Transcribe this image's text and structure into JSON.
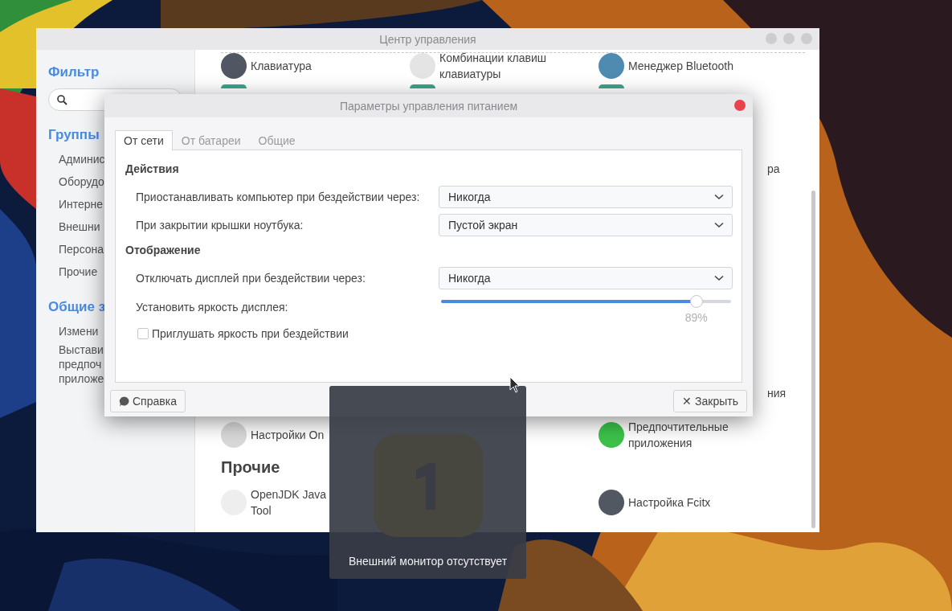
{
  "main_window": {
    "title": "Центр управления",
    "sidebar": {
      "filter_title": "Фильтр",
      "sections": [
        {
          "title": "Группы",
          "items": [
            "Админис",
            "Оборудо",
            "Интерне",
            "Внешни",
            "Персона",
            "Прочие"
          ]
        },
        {
          "title": "Общие з",
          "items": [
            "Измени",
            "Выстави\nпредпоч\nприложе"
          ]
        }
      ]
    },
    "top_rows": [
      {
        "items": [
          {
            "label": "Клавиатура"
          },
          {
            "label": "Комбинации клавиш\nклавиатуры"
          },
          {
            "label": "Менеджер Bluetooth"
          }
        ]
      }
    ],
    "fragment_top": "ра",
    "fragment_bottom": "ния",
    "bottom_rows": [
      {
        "items": [
          {
            "label": "Настройки On"
          },
          {
            "label": "Предпочтительные\nприложения"
          }
        ]
      }
    ],
    "other_title": "Прочие",
    "other_rows": [
      {
        "items": [
          {
            "label": "OpenJDK Java\nTool"
          },
          {
            "label": "Настройка Fcitx"
          }
        ]
      }
    ]
  },
  "dialog": {
    "title": "Параметры управления питанием",
    "tabs": [
      {
        "label": "От сети",
        "selected": true
      },
      {
        "label": "От батареи",
        "selected": false
      },
      {
        "label": "Общие",
        "selected": false
      }
    ],
    "sections": [
      {
        "title": "Действия",
        "rows": [
          {
            "kind": "combo",
            "label": "Приостанавливать компьютер при бездействии через:",
            "value": "Никогда"
          },
          {
            "kind": "combo",
            "label": "При закрытии крышки ноутбука:",
            "value": "Пустой экран"
          }
        ]
      },
      {
        "title": "Отображение",
        "rows": [
          {
            "kind": "combo",
            "label": "Отключать дисплей при бездействии через:",
            "value": "Никогда"
          },
          {
            "kind": "slider",
            "label": "Установить яркость дисплея:",
            "level": 0.88,
            "reading": "89%"
          },
          {
            "kind": "checkbox",
            "label": "Приглушать яркость при бездействии",
            "checked": false
          }
        ]
      }
    ],
    "help_button": "Справка",
    "close_button": "✕ Закрыть"
  },
  "osd": {
    "message": "Внешний монитор отсутствует"
  }
}
